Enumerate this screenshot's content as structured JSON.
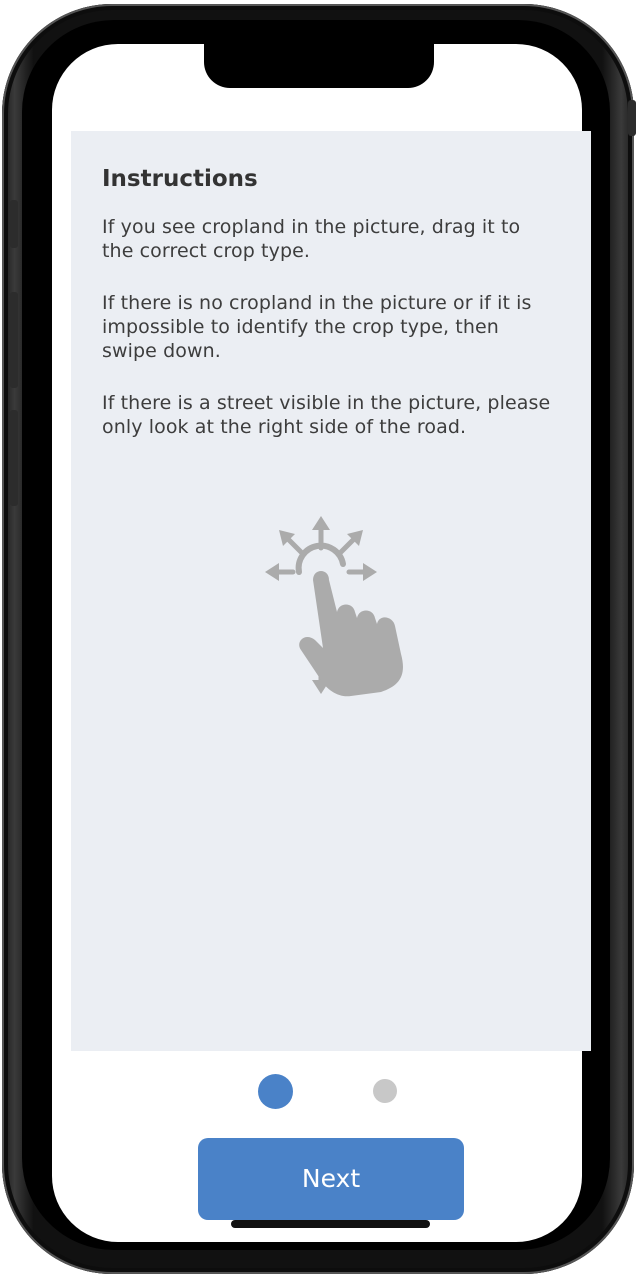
{
  "instructions": {
    "title": "Instructions",
    "paragraphs": [
      "If you see cropland in the picture, drag it to the correct crop type.",
      "If there is no cropland in the picture or if it is impossible to identify the crop type, then swipe down.",
      "If there is a street visible in the picture, please only look at the right side of the road."
    ],
    "gesture_icon": "swipe-gesture-hand-icon"
  },
  "pager": {
    "page_count": 2,
    "active_page": 1
  },
  "next_button": {
    "label": "Next"
  },
  "colors": {
    "accent": "#4a82c8",
    "card_background": "#ebeef3",
    "icon_gray": "#ababab",
    "dot_inactive": "#c8c8c8"
  }
}
